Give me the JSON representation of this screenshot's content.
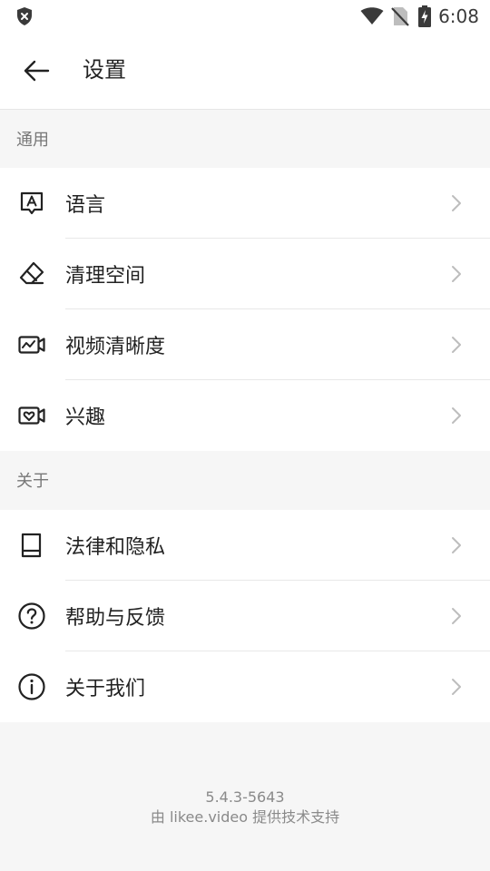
{
  "status_bar": {
    "time": "6:08"
  },
  "header": {
    "title": "设置"
  },
  "sections": [
    {
      "title": "通用",
      "items": [
        {
          "label": "语言",
          "icon": "language-icon"
        },
        {
          "label": "清理空间",
          "icon": "eraser-icon"
        },
        {
          "label": "视频清晰度",
          "icon": "video-quality-icon"
        },
        {
          "label": "兴趣",
          "icon": "interest-icon"
        }
      ]
    },
    {
      "title": "关于",
      "items": [
        {
          "label": "法律和隐私",
          "icon": "book-icon"
        },
        {
          "label": "帮助与反馈",
          "icon": "help-icon"
        },
        {
          "label": "关于我们",
          "icon": "info-icon"
        }
      ]
    }
  ],
  "footer": {
    "version": "5.4.3-5643",
    "powered_by": "由 likee.video 提供技术支持"
  }
}
